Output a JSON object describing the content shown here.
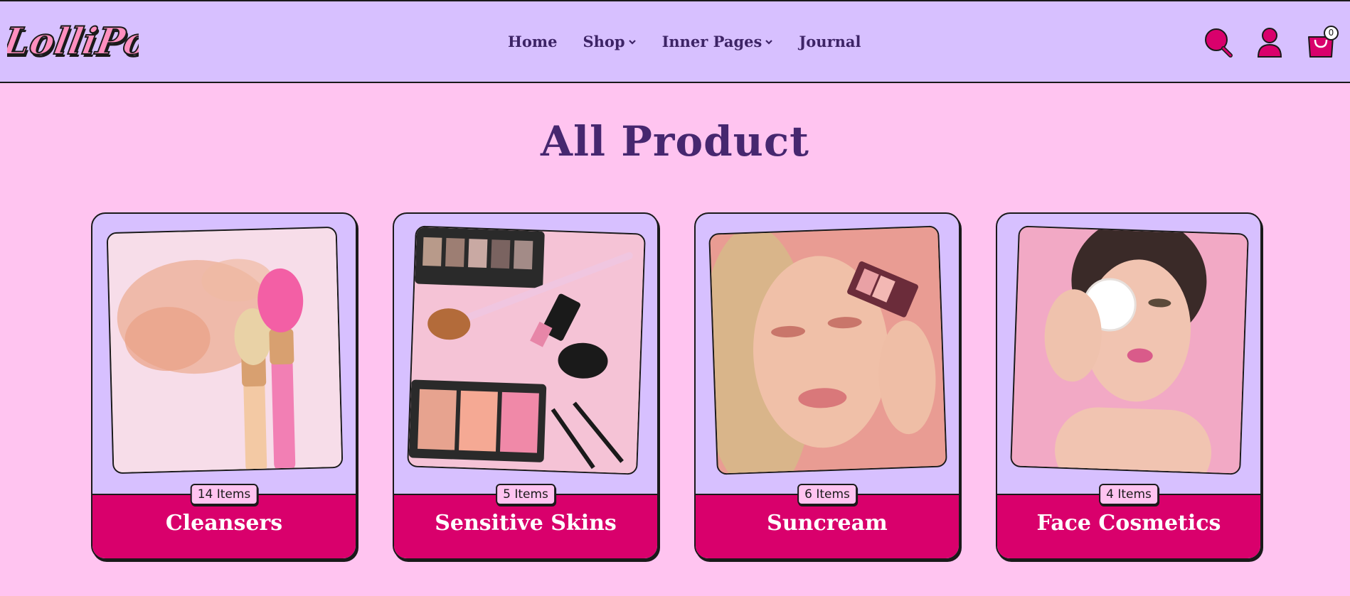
{
  "brand": {
    "logo_text": "LolliPop"
  },
  "nav": [
    {
      "label": "Home",
      "has_dropdown": false
    },
    {
      "label": "Shop",
      "has_dropdown": true
    },
    {
      "label": "Inner Pages",
      "has_dropdown": true
    },
    {
      "label": "Journal",
      "has_dropdown": false
    }
  ],
  "header_icons": {
    "search": "search-icon",
    "account": "user-icon",
    "cart": "shopping-bag-icon",
    "cart_count": "0"
  },
  "page": {
    "title": "All Product"
  },
  "categories": [
    {
      "name": "Cleansers",
      "count": "14 Items",
      "image": "powder-and-brushes-photo"
    },
    {
      "name": "Sensitive Skins",
      "count": "5 Items",
      "image": "makeup-flatlay-photo"
    },
    {
      "name": "Suncream",
      "count": "6 Items",
      "image": "woman-with-eyeshadow-palette-photo"
    },
    {
      "name": "Face Cosmetics",
      "count": "4 Items",
      "image": "woman-with-cotton-pad-photo"
    }
  ],
  "colors": {
    "header_bg": "#d7c0ff",
    "page_bg": "#ffc4f0",
    "accent": "#d9006c",
    "title": "#46276f"
  }
}
